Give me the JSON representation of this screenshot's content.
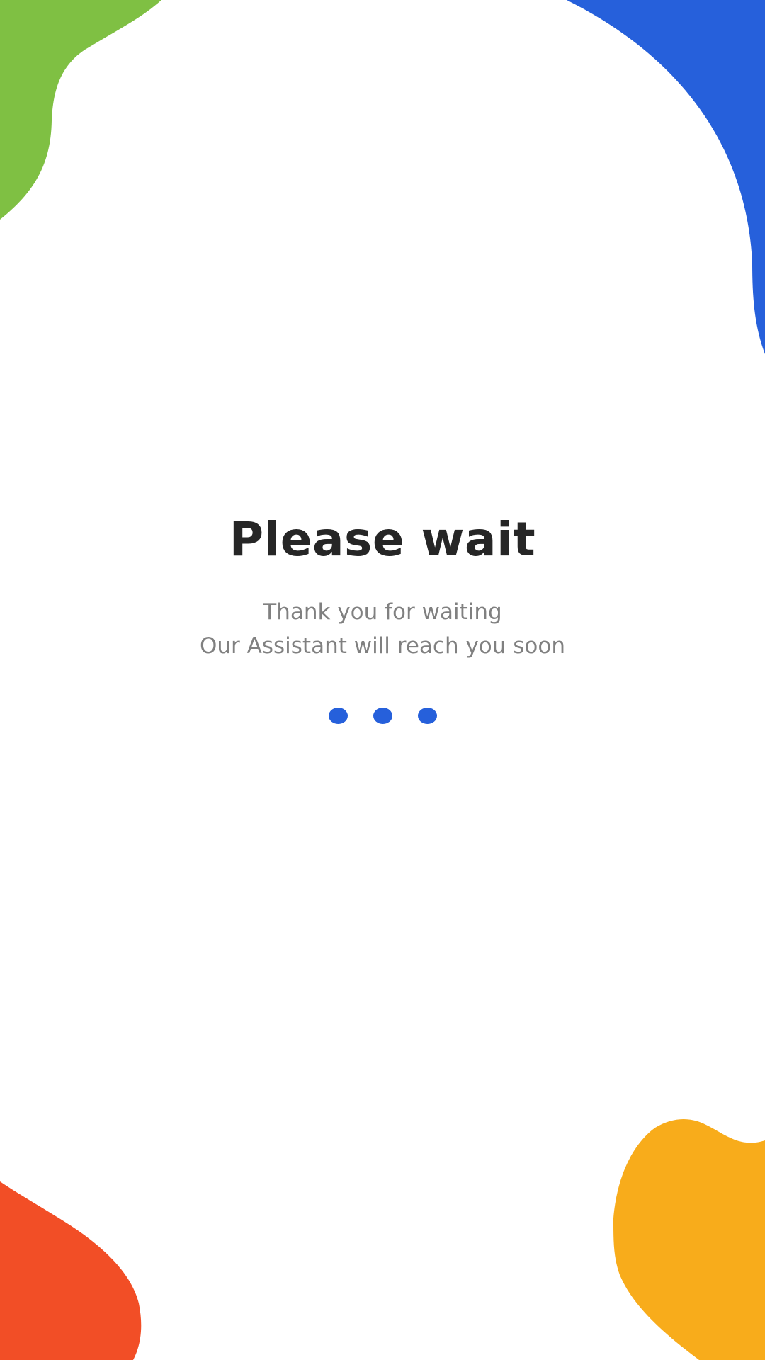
{
  "screen": {
    "title": "Please wait",
    "message_line_1": "Thank you for waiting",
    "message_line_2": "Our Assistant will reach you soon"
  },
  "loading_indicator": {
    "dot_count": 3,
    "dot_color": "#2660db"
  },
  "colors": {
    "background": "#ffffff",
    "title": "#262626",
    "message": "#808080",
    "blob_top_left": "#7fc043",
    "blob_top_right": "#2660db",
    "blob_bottom_left": "#f24e26",
    "blob_bottom_right": "#f8ac1b"
  }
}
